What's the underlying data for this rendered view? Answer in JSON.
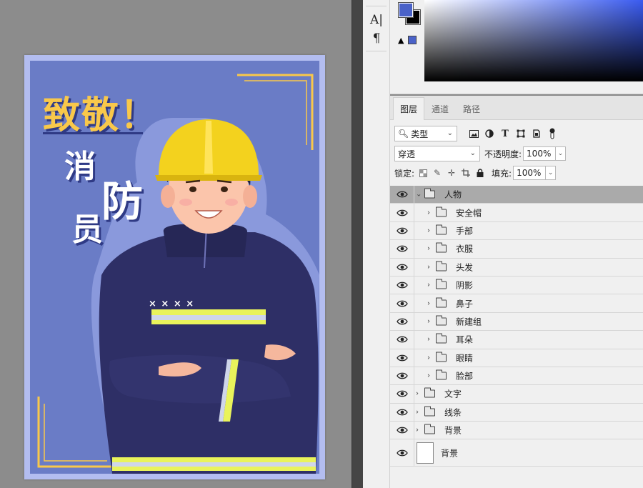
{
  "colors": {
    "canvas_bg": "#8c8c8c",
    "poster_border": "#b3bdf0",
    "poster_bg": "#6a7cc6",
    "title_yellow": "#f9c84a",
    "title_shadow": "#2f3a85",
    "foreground_swatch": "#4a62c8",
    "background_swatch": "#000000",
    "selected_layer": "#aaaaaa"
  },
  "poster": {
    "title": "致敬！",
    "sub_chars": [
      "消",
      "防",
      "员"
    ],
    "badge_text": "× × × ×"
  },
  "toolbar": {
    "text_tool_icon": "text-cursor-icon",
    "paragraph_icon": "paragraph-icon",
    "char_tool_label": "A|",
    "para_tool_label": "¶"
  },
  "color_panel": {
    "warning_icon": "▲"
  },
  "layers_panel": {
    "tabs": [
      "图层",
      "通道",
      "路径"
    ],
    "active_tab": "图层",
    "filter": {
      "value": "类型",
      "icon": "search-icon"
    },
    "filter_icons": [
      "image-filter-icon",
      "adjustment-filter-icon",
      "type-filter-icon",
      "shape-filter-icon",
      "smart-object-filter-icon",
      "toggle-filter-icon"
    ],
    "blend_mode": "穿透",
    "opacity_label": "不透明度:",
    "opacity_value": "100%",
    "lock_label": "锁定:",
    "fill_label": "填充:",
    "fill_value": "100%",
    "layers": [
      {
        "name": "人物",
        "type": "group",
        "indent": 0,
        "expanded": true,
        "selected": true
      },
      {
        "name": "安全帽",
        "type": "group",
        "indent": 1,
        "expanded": false,
        "selected": false
      },
      {
        "name": "手部",
        "type": "group",
        "indent": 1,
        "expanded": false,
        "selected": false
      },
      {
        "name": "衣服",
        "type": "group",
        "indent": 1,
        "expanded": false,
        "selected": false
      },
      {
        "name": "头发",
        "type": "group",
        "indent": 1,
        "expanded": false,
        "selected": false
      },
      {
        "name": "阴影",
        "type": "group",
        "indent": 1,
        "expanded": false,
        "selected": false
      },
      {
        "name": "鼻子",
        "type": "group",
        "indent": 1,
        "expanded": false,
        "selected": false
      },
      {
        "name": "新建组",
        "type": "group",
        "indent": 1,
        "expanded": false,
        "selected": false
      },
      {
        "name": "耳朵",
        "type": "group",
        "indent": 1,
        "expanded": false,
        "selected": false
      },
      {
        "name": "眼睛",
        "type": "group",
        "indent": 1,
        "expanded": false,
        "selected": false
      },
      {
        "name": "脸部",
        "type": "group",
        "indent": 1,
        "expanded": false,
        "selected": false
      },
      {
        "name": "文字",
        "type": "group",
        "indent": 0,
        "expanded": false,
        "selected": false
      },
      {
        "name": "线条",
        "type": "group",
        "indent": 0,
        "expanded": false,
        "selected": false
      },
      {
        "name": "背景",
        "type": "group",
        "indent": 0,
        "expanded": false,
        "selected": false
      },
      {
        "name": "背景",
        "type": "pixel",
        "indent": 0,
        "expanded": false,
        "selected": false
      }
    ]
  }
}
